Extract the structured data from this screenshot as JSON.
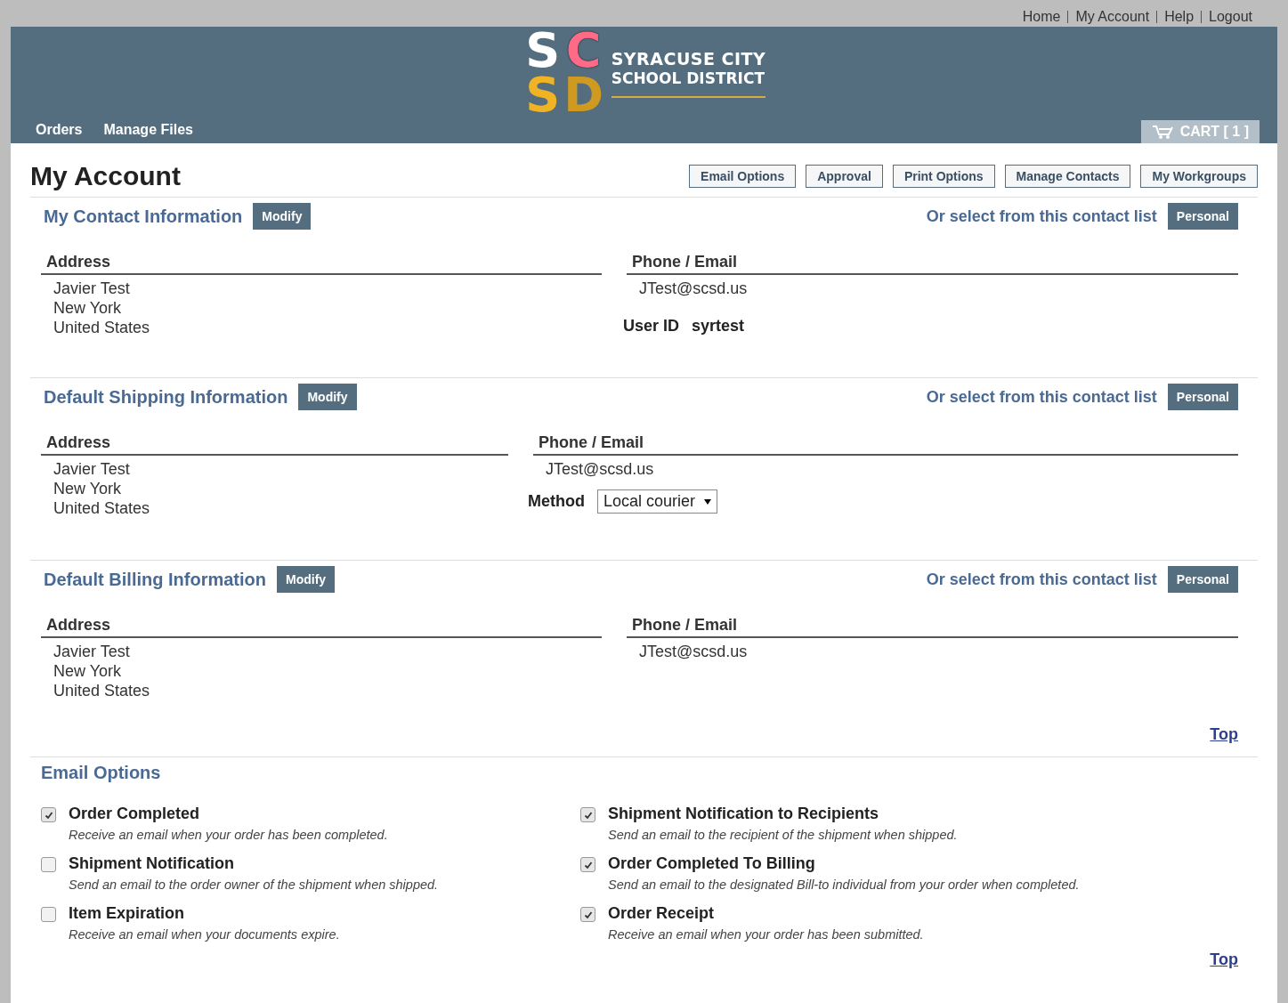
{
  "top_links": [
    "Home",
    "My Account",
    "Help",
    "Logout"
  ],
  "logo": {
    "letters": [
      "S",
      "C",
      "S",
      "D"
    ],
    "line1": "SYRACUSE CITY",
    "line2": "SCHOOL DISTRICT"
  },
  "nav": [
    "Orders",
    "Manage Files"
  ],
  "cart": "CART [ 1 ]",
  "page_title": "My Account",
  "toolbar": [
    "Email Options",
    "Approval",
    "Print Options",
    "Manage Contacts",
    "My Workgroups"
  ],
  "sections": [
    {
      "kind": "contact",
      "title": "My Contact Information",
      "modify": "Modify",
      "list_label": "Or select from this contact list",
      "list_button": "Personal",
      "address_heading": "Address",
      "address_lines": [
        "Javier Test",
        "New York",
        "United States"
      ],
      "contact_heading": "Phone / Email",
      "email": "JTest@scsd.us",
      "extra": {
        "kind": "user_id",
        "label": "User ID",
        "value": "syrtest"
      }
    },
    {
      "kind": "shipping",
      "title": "Default Shipping Information",
      "modify": "Modify",
      "list_label": "Or select from this contact list",
      "list_button": "Personal",
      "address_heading": "Address",
      "address_lines": [
        "Javier Test",
        "New York",
        "United States"
      ],
      "contact_heading": "Phone / Email",
      "email": "JTest@scsd.us",
      "extra": {
        "kind": "method",
        "label": "Method",
        "value": "Local courier"
      }
    },
    {
      "kind": "billing",
      "title": "Default Billing Information",
      "modify": "Modify",
      "list_label": "Or select from this contact list",
      "list_button": "Personal",
      "address_heading": "Address",
      "address_lines": [
        "Javier Test",
        "New York",
        "United States"
      ],
      "contact_heading": "Phone / Email",
      "email": "JTest@scsd.us",
      "top_link": "Top"
    }
  ],
  "email_options": {
    "title": "Email Options",
    "items": [
      {
        "title": "Order Completed",
        "description": "Receive an email when your order has been completed.",
        "checked": true
      },
      {
        "title": "Shipment Notification to Recipients",
        "description": "Send an email to the recipient of the shipment when shipped.",
        "checked": true
      },
      {
        "title": "Shipment Notification",
        "description": "Send an email to the order owner of the shipment when shipped.",
        "checked": false
      },
      {
        "title": "Order Completed To Billing",
        "description": "Send an email to the designated Bill-to individual from your order when completed.",
        "checked": true
      },
      {
        "title": "Item Expiration",
        "description": "Receive an email when your documents expire.",
        "checked": false
      },
      {
        "title": "Order Receipt",
        "description": "Receive an email when your order has been submitted.",
        "checked": true
      }
    ],
    "top_link": "Top"
  }
}
